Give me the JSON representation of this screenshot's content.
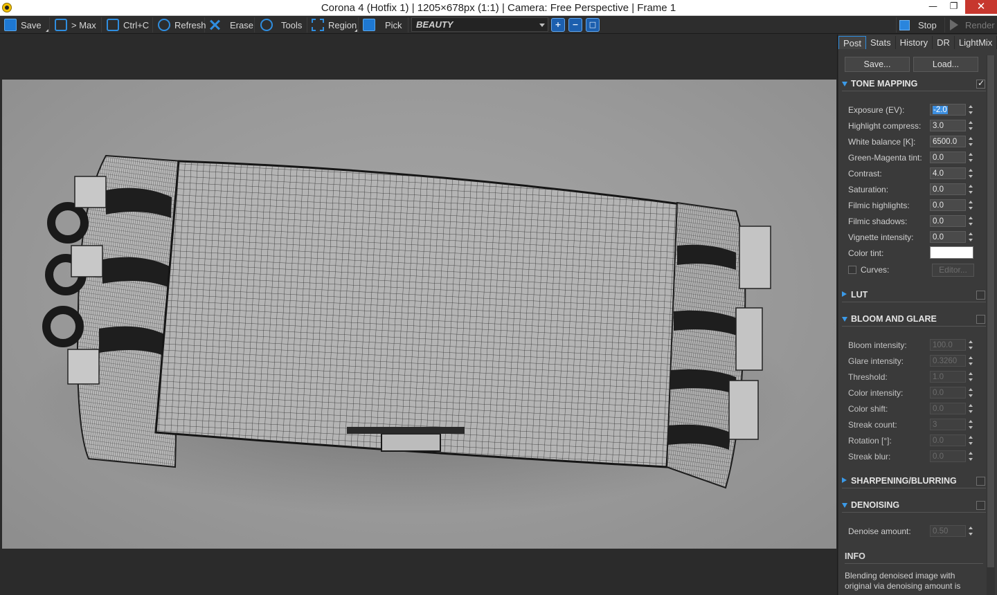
{
  "window": {
    "title": "Corona 4 (Hotfix 1) | 1205×678px (1:1) | Camera: Free Perspective | Frame 1",
    "controls": {
      "minimize": "—",
      "maximize": "❐",
      "close": "✕"
    }
  },
  "toolbar": {
    "buttons": [
      {
        "label": "Save",
        "icon": "save-icon"
      },
      {
        "label": "> Max",
        "icon": "send-to-max-icon"
      },
      {
        "label": "Ctrl+C",
        "icon": "copy-icon"
      },
      {
        "label": "Refresh",
        "icon": "refresh-icon"
      },
      {
        "label": "Erase",
        "icon": "erase-icon"
      },
      {
        "label": "Tools",
        "icon": "gear-icon"
      },
      {
        "label": "Region",
        "icon": "region-icon"
      },
      {
        "label": "Pick",
        "icon": "pick-hand-icon"
      }
    ],
    "render_pass": "BEAUTY",
    "zoom_in": "+",
    "zoom_out": "−",
    "zoom_fit": "□",
    "stop_label": "Stop",
    "render_label": "Render"
  },
  "panel": {
    "tabs": [
      "Post",
      "Stats",
      "History",
      "DR",
      "LightMix"
    ],
    "active_tab": "Post",
    "save_label": "Save...",
    "load_label": "Load...",
    "tone_mapping": {
      "title": "TONE MAPPING",
      "enabled": true,
      "rows": [
        {
          "label": "Exposure (EV):",
          "value": "-2.0"
        },
        {
          "label": "Highlight compress:",
          "value": "3.0"
        },
        {
          "label": "White balance [K]:",
          "value": "6500.0"
        },
        {
          "label": "Green-Magenta tint:",
          "value": "0.0"
        },
        {
          "label": "Contrast:",
          "value": "4.0"
        },
        {
          "label": "Saturation:",
          "value": "0.0"
        },
        {
          "label": "Filmic highlights:",
          "value": "0.0"
        },
        {
          "label": "Filmic shadows:",
          "value": "0.0"
        },
        {
          "label": "Vignette intensity:",
          "value": "0.0"
        }
      ],
      "color_tint_label": "Color tint:",
      "color_tint_value": "#ffffff",
      "curves_label": "Curves:",
      "editor_label": "Editor..."
    },
    "lut": {
      "title": "LUT",
      "enabled": false
    },
    "bloom_and_glare": {
      "title": "BLOOM AND GLARE",
      "enabled": false,
      "rows": [
        {
          "label": "Bloom intensity:",
          "value": "100.0"
        },
        {
          "label": "Glare intensity:",
          "value": "0.3260"
        },
        {
          "label": "Threshold:",
          "value": "1.0"
        },
        {
          "label": "Color intensity:",
          "value": "0.0"
        },
        {
          "label": "Color shift:",
          "value": "0.0"
        },
        {
          "label": "Streak count:",
          "value": "3"
        },
        {
          "label": "Rotation [°]:",
          "value": "0.0"
        },
        {
          "label": "Streak blur:",
          "value": "0.0"
        }
      ]
    },
    "sharpening": {
      "title": "SHARPENING/BLURRING",
      "enabled": false
    },
    "denoising": {
      "title": "DENOISING",
      "enabled": false,
      "amount_label": "Denoise amount:",
      "amount_value": "0.50"
    },
    "info": {
      "title": "INFO",
      "text": "Blending denoised image with original via denoising amount is"
    }
  }
}
